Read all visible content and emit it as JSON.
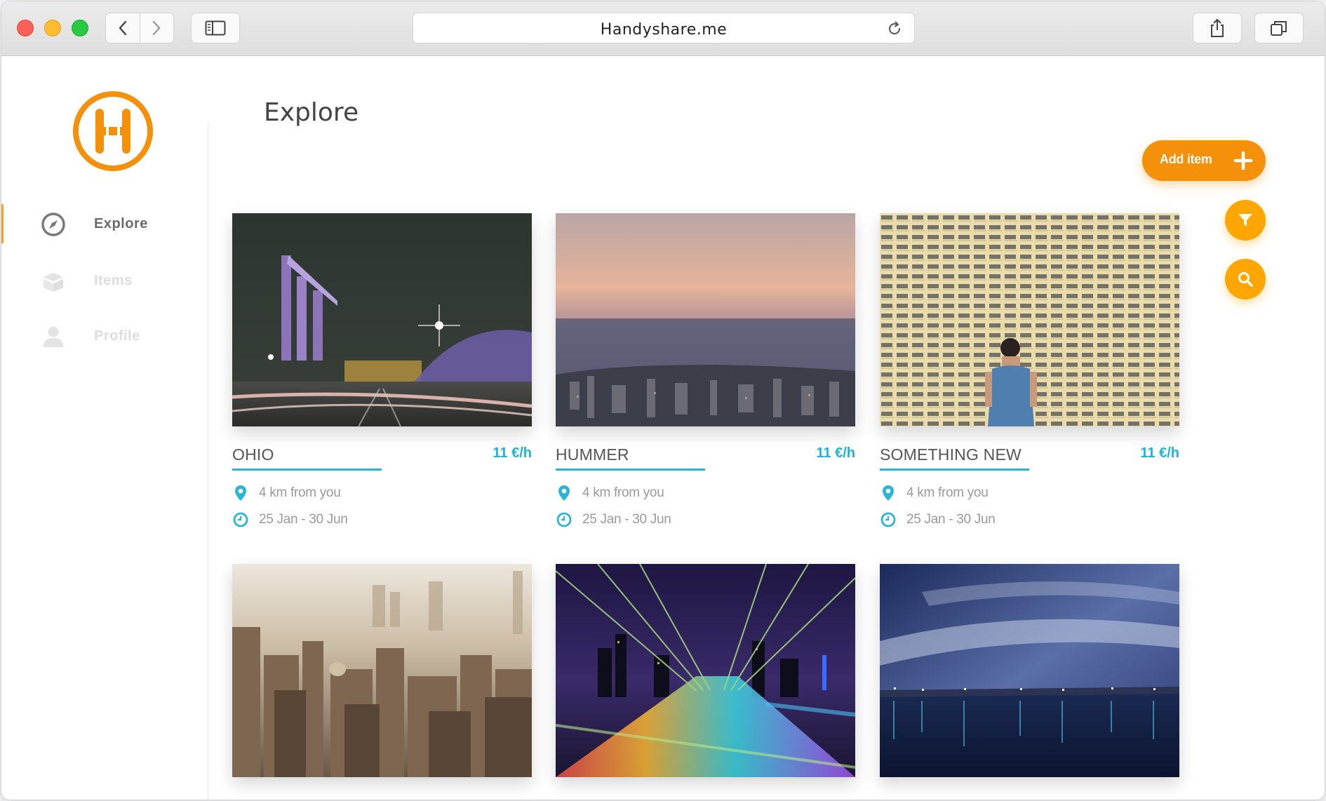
{
  "browser": {
    "url": "Handyshare.me"
  },
  "sidebar": {
    "items": [
      {
        "label": "Explore",
        "icon": "compass-icon",
        "active": true
      },
      {
        "label": "Items",
        "icon": "box-icon",
        "active": false
      },
      {
        "label": "Profile",
        "icon": "user-icon",
        "active": false
      }
    ]
  },
  "main": {
    "title": "Explore",
    "add_button_label": "Add item"
  },
  "cards": [
    {
      "title": "OHIO",
      "price": "11 €/h",
      "distance": "4 km from you",
      "dates": "25 Jan - 30 Jun",
      "image": "city-night-skyline"
    },
    {
      "title": "HUMMER",
      "price": "11 €/h",
      "distance": "4 km from you",
      "dates": "25 Jan - 30 Jun",
      "image": "sunset-coast-city"
    },
    {
      "title": "SOMETHING NEW",
      "price": "11 €/h",
      "distance": "4 km from you",
      "dates": "25 Jan - 30 Jun",
      "image": "apartment-facade-person"
    },
    {
      "title": "",
      "price": "",
      "distance": "",
      "dates": "",
      "image": "hazy-old-city"
    },
    {
      "title": "",
      "price": "",
      "distance": "",
      "dates": "",
      "image": "bridge-night-lights"
    },
    {
      "title": "",
      "price": "",
      "distance": "",
      "dates": "",
      "image": "night-lake-clouds"
    }
  ],
  "colors": {
    "accent_orange": "#f5900a",
    "fab_yellow": "#ffa700",
    "accent_cyan": "#29b5d3"
  }
}
